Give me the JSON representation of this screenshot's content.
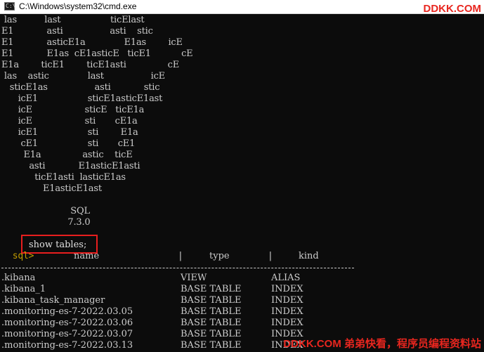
{
  "window": {
    "title": "C:\\Windows\\system32\\cmd.exe",
    "icon": "cmd-icon",
    "icon_text": "C:\\",
    "watermark_top": "DDKK.COM"
  },
  "banner": [
    " las          last                  ticElast",
    "E1            asti                 asti    stic",
    "E1            asticE1a              E1as        icE",
    "E1            E1as  cE1asticE   ticE1           cE",
    "E1a        ticE1        ticE1asti               cE",
    " las    astic              last                 icE",
    "   sticE1as                 asti            stic",
    "      icE1                  sticE1asticE1ast",
    "      icE                   sticE   ticE1a",
    "      icE                   sti       cE1a",
    "      icE1                  sti        E1a",
    "       cE1                  sti       cE1",
    "        E1a               astic    ticE",
    "          asti            E1asticE1asti",
    "            ticE1asti  lasticE1as",
    "               E1asticE1ast",
    "",
    "                         SQL",
    "                        7.3.0"
  ],
  "prompt": {
    "label": "sql>",
    "command": "show tables;"
  },
  "table": {
    "headers": [
      "name",
      "type",
      "kind"
    ],
    "rows": [
      [
        ".kibana",
        "VIEW",
        "ALIAS"
      ],
      [
        ".kibana_1",
        "BASE TABLE",
        "INDEX"
      ],
      [
        ".kibana_task_manager",
        "BASE TABLE",
        "INDEX"
      ],
      [
        ".monitoring-es-7-2022.03.05",
        "BASE TABLE",
        "INDEX"
      ],
      [
        ".monitoring-es-7-2022.03.06",
        "BASE TABLE",
        "INDEX"
      ],
      [
        ".monitoring-es-7-2022.03.07",
        "BASE TABLE",
        "INDEX"
      ],
      [
        ".monitoring-es-7-2022.03.13",
        "BASE TABLE",
        "INDEX"
      ]
    ]
  },
  "watermark_bottom": "DDKK.COM 弟弟快看，程序员编程资料站",
  "colors": {
    "background": "#0c0c0c",
    "text": "#cccccc",
    "prompt": "#c19c00",
    "highlight": "#e81e1e",
    "watermark": "#e8261f"
  }
}
